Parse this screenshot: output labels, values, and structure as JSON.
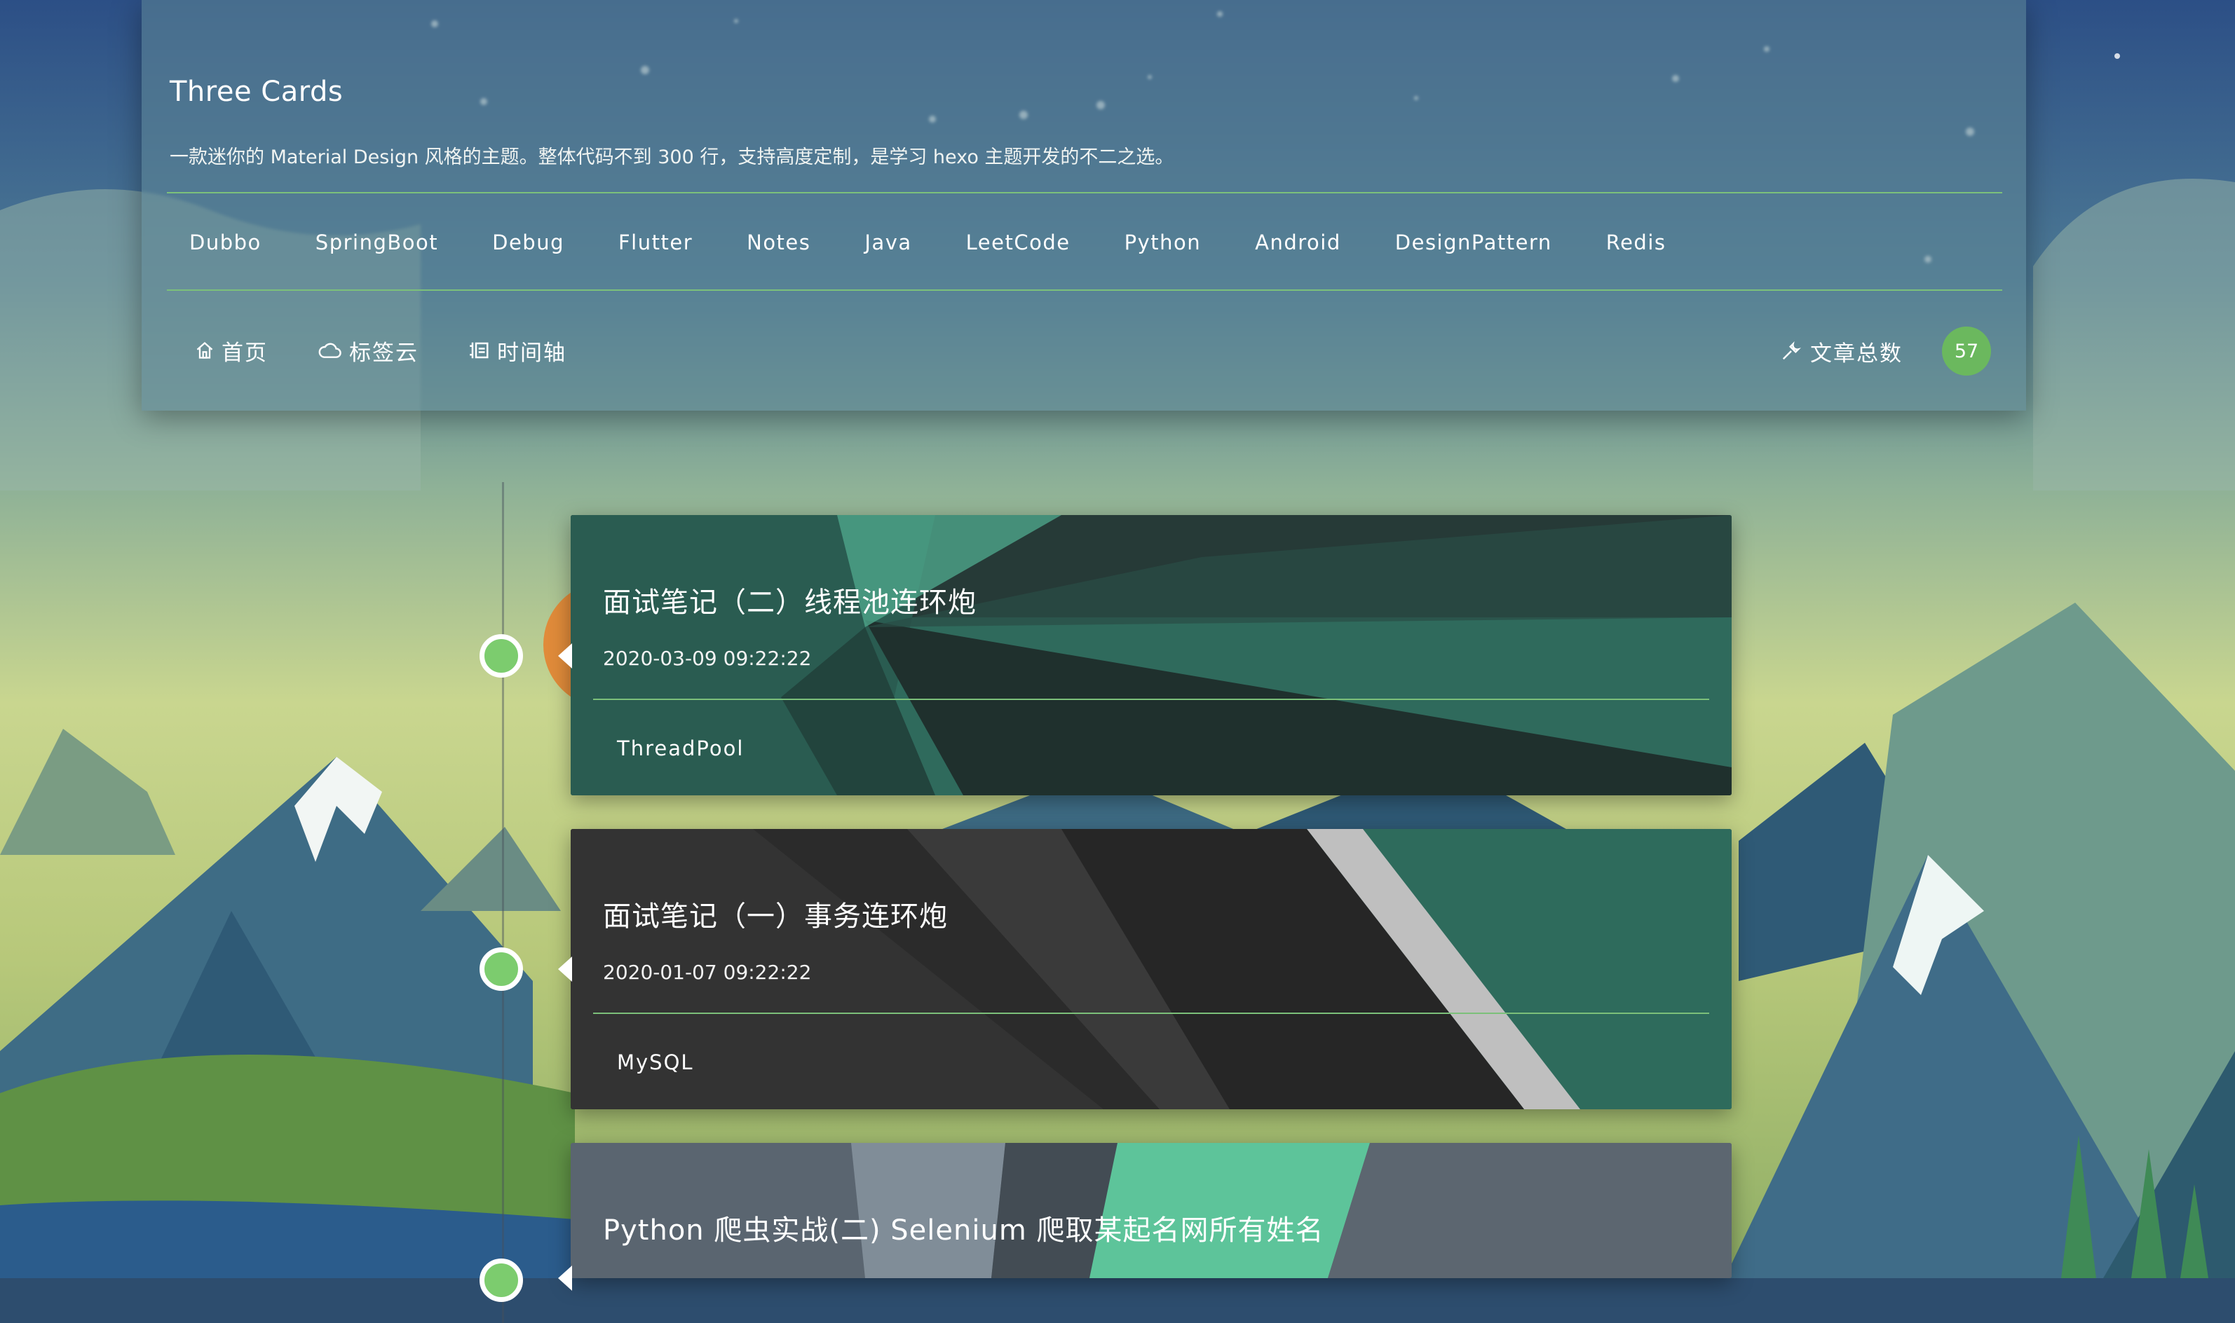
{
  "site": {
    "title": "Three Cards",
    "description": "一款迷你的 Material Design 风格的主题。整体代码不到 300 行，支持高度定制，是学习 hexo 主题开发的不二之选。"
  },
  "tags": [
    "Dubbo",
    "SpringBoot",
    "Debug",
    "Flutter",
    "Notes",
    "Java",
    "LeetCode",
    "Python",
    "Android",
    "DesignPattern",
    "Redis"
  ],
  "nav": {
    "home": {
      "label": "首页",
      "icon": "home-icon"
    },
    "tag_cloud": {
      "label": "标签云",
      "icon": "cloud-icon"
    },
    "timeline": {
      "label": "时间轴",
      "icon": "timeline-icon"
    },
    "article_count": {
      "label": "文章总数",
      "value": "57",
      "icon": "tool-icon"
    }
  },
  "posts": [
    {
      "title": "面试笔记（二）线程池连环炮",
      "date": "2020-03-09 09:22:22",
      "tag": "ThreadPool"
    },
    {
      "title": "面试笔记（一）事务连环炮",
      "date": "2020-01-07 09:22:22",
      "tag": "MySQL"
    },
    {
      "title": "Python 爬虫实战(二) Selenium 爬取某起名网所有姓名",
      "date": "",
      "tag": ""
    }
  ],
  "colors": {
    "accent": "#7cc07a",
    "badge": "#6bb85e",
    "dot": "#7ccc6e"
  }
}
